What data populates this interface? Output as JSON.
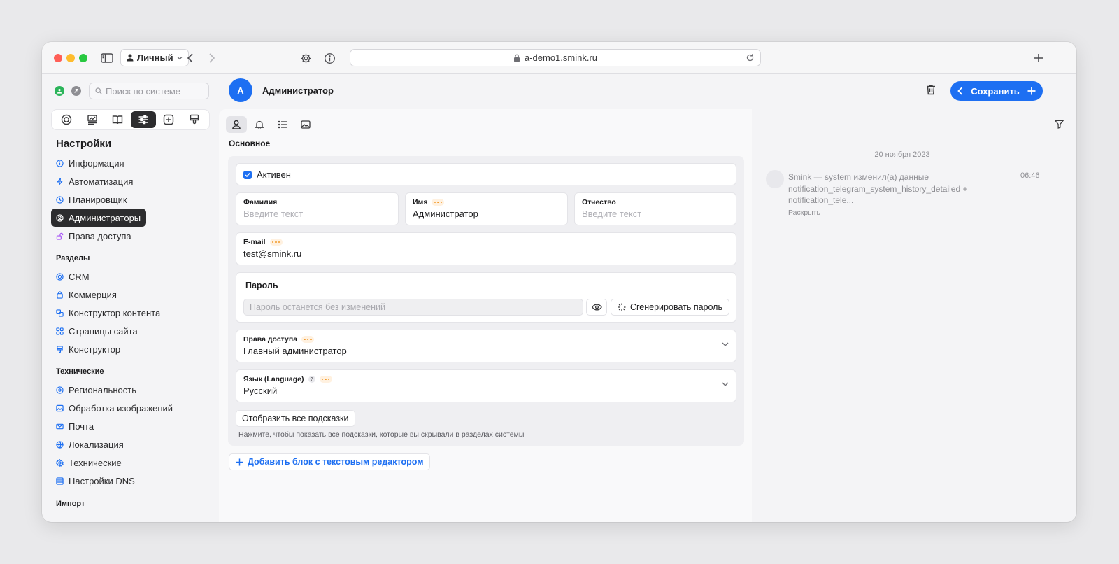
{
  "browser": {
    "profile_label": "Личный",
    "url": "a-demo1.smink.ru"
  },
  "sidebar": {
    "search_placeholder": "Поиск по системе",
    "title": "Настройки",
    "settings_items": [
      {
        "label": "Информация",
        "icon": "info-icon",
        "color": "#1d6ff2"
      },
      {
        "label": "Автоматизация",
        "icon": "bolt-icon",
        "color": "#1d6ff2"
      },
      {
        "label": "Планировщик",
        "icon": "clock-icon",
        "color": "#1d6ff2"
      },
      {
        "label": "Администраторы",
        "icon": "user-circle-icon",
        "color": "#ffffff"
      },
      {
        "label": "Права доступа",
        "icon": "unlock-icon",
        "color": "#a855f7"
      }
    ],
    "group_sections": "Разделы",
    "section_items": [
      {
        "label": "CRM",
        "icon": "crm-icon",
        "color": "#1d6ff2"
      },
      {
        "label": "Коммерция",
        "icon": "bag-icon",
        "color": "#1d6ff2"
      },
      {
        "label": "Конструктор контента",
        "icon": "content-builder-icon",
        "color": "#1d6ff2"
      },
      {
        "label": "Страницы сайта",
        "icon": "grid-icon",
        "color": "#1d6ff2"
      },
      {
        "label": "Конструктор",
        "icon": "brush-icon",
        "color": "#1d6ff2"
      }
    ],
    "group_technical": "Технические",
    "technical_items": [
      {
        "label": "Региональность",
        "icon": "location-icon",
        "color": "#1d6ff2"
      },
      {
        "label": "Обработка изображений",
        "icon": "image-icon",
        "color": "#1d6ff2"
      },
      {
        "label": "Почта",
        "icon": "mail-icon",
        "color": "#1d6ff2"
      },
      {
        "label": "Локализация",
        "icon": "globe-icon",
        "color": "#1d6ff2"
      },
      {
        "label": "Технические",
        "icon": "gear-icon",
        "color": "#1d6ff2"
      },
      {
        "label": "Настройки DNS",
        "icon": "server-icon",
        "color": "#1d6ff2"
      }
    ],
    "group_import": "Импорт"
  },
  "header": {
    "avatar_letter": "A",
    "title": "Администратор",
    "save_label": "Сохранить"
  },
  "form": {
    "section_label": "Основное",
    "active_label": "Активен",
    "lastname_label": "Фамилия",
    "lastname_placeholder": "Введите текст",
    "firstname_label": "Имя",
    "firstname_value": "Администратор",
    "middlename_label": "Отчество",
    "middlename_placeholder": "Введите текст",
    "email_label": "E-mail",
    "email_value": "test@smink.ru",
    "password_title": "Пароль",
    "password_placeholder": "Пароль останется без изменений",
    "generate_label": "Сгенерировать пароль",
    "access_label": "Права доступа",
    "access_value": "Главный администратор",
    "language_label": "Язык (Language)",
    "language_value": "Русский",
    "hints_button": "Отобразить все подсказки",
    "hints_note": "Нажмите, чтобы показать все подсказки, которые вы скрывали в разделах системы",
    "add_block_label": "Добавить блок с текстовым редактором"
  },
  "history": {
    "date": "20 ноября 2023",
    "entry_text": "Smink — system изменил(а) данные notification_telegram_system_history_detailed + notification_tele...",
    "entry_time": "06:46",
    "expand_label": "Раскрыть"
  },
  "colors": {
    "accent": "#1d6ff2",
    "active_nav": "#2c2c2e",
    "status_online": "#2bb45a"
  }
}
